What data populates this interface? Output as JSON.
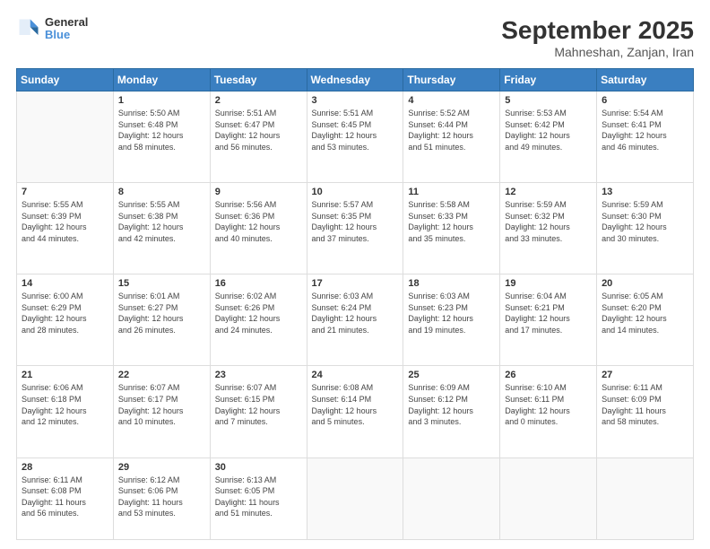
{
  "header": {
    "logo": {
      "line1": "General",
      "line2": "Blue"
    },
    "title": "September 2025",
    "location": "Mahneshan, Zanjan, Iran"
  },
  "days_of_week": [
    "Sunday",
    "Monday",
    "Tuesday",
    "Wednesday",
    "Thursday",
    "Friday",
    "Saturday"
  ],
  "weeks": [
    [
      {
        "day": "",
        "info": ""
      },
      {
        "day": "1",
        "info": "Sunrise: 5:50 AM\nSunset: 6:48 PM\nDaylight: 12 hours\nand 58 minutes."
      },
      {
        "day": "2",
        "info": "Sunrise: 5:51 AM\nSunset: 6:47 PM\nDaylight: 12 hours\nand 56 minutes."
      },
      {
        "day": "3",
        "info": "Sunrise: 5:51 AM\nSunset: 6:45 PM\nDaylight: 12 hours\nand 53 minutes."
      },
      {
        "day": "4",
        "info": "Sunrise: 5:52 AM\nSunset: 6:44 PM\nDaylight: 12 hours\nand 51 minutes."
      },
      {
        "day": "5",
        "info": "Sunrise: 5:53 AM\nSunset: 6:42 PM\nDaylight: 12 hours\nand 49 minutes."
      },
      {
        "day": "6",
        "info": "Sunrise: 5:54 AM\nSunset: 6:41 PM\nDaylight: 12 hours\nand 46 minutes."
      }
    ],
    [
      {
        "day": "7",
        "info": "Sunrise: 5:55 AM\nSunset: 6:39 PM\nDaylight: 12 hours\nand 44 minutes."
      },
      {
        "day": "8",
        "info": "Sunrise: 5:55 AM\nSunset: 6:38 PM\nDaylight: 12 hours\nand 42 minutes."
      },
      {
        "day": "9",
        "info": "Sunrise: 5:56 AM\nSunset: 6:36 PM\nDaylight: 12 hours\nand 40 minutes."
      },
      {
        "day": "10",
        "info": "Sunrise: 5:57 AM\nSunset: 6:35 PM\nDaylight: 12 hours\nand 37 minutes."
      },
      {
        "day": "11",
        "info": "Sunrise: 5:58 AM\nSunset: 6:33 PM\nDaylight: 12 hours\nand 35 minutes."
      },
      {
        "day": "12",
        "info": "Sunrise: 5:59 AM\nSunset: 6:32 PM\nDaylight: 12 hours\nand 33 minutes."
      },
      {
        "day": "13",
        "info": "Sunrise: 5:59 AM\nSunset: 6:30 PM\nDaylight: 12 hours\nand 30 minutes."
      }
    ],
    [
      {
        "day": "14",
        "info": "Sunrise: 6:00 AM\nSunset: 6:29 PM\nDaylight: 12 hours\nand 28 minutes."
      },
      {
        "day": "15",
        "info": "Sunrise: 6:01 AM\nSunset: 6:27 PM\nDaylight: 12 hours\nand 26 minutes."
      },
      {
        "day": "16",
        "info": "Sunrise: 6:02 AM\nSunset: 6:26 PM\nDaylight: 12 hours\nand 24 minutes."
      },
      {
        "day": "17",
        "info": "Sunrise: 6:03 AM\nSunset: 6:24 PM\nDaylight: 12 hours\nand 21 minutes."
      },
      {
        "day": "18",
        "info": "Sunrise: 6:03 AM\nSunset: 6:23 PM\nDaylight: 12 hours\nand 19 minutes."
      },
      {
        "day": "19",
        "info": "Sunrise: 6:04 AM\nSunset: 6:21 PM\nDaylight: 12 hours\nand 17 minutes."
      },
      {
        "day": "20",
        "info": "Sunrise: 6:05 AM\nSunset: 6:20 PM\nDaylight: 12 hours\nand 14 minutes."
      }
    ],
    [
      {
        "day": "21",
        "info": "Sunrise: 6:06 AM\nSunset: 6:18 PM\nDaylight: 12 hours\nand 12 minutes."
      },
      {
        "day": "22",
        "info": "Sunrise: 6:07 AM\nSunset: 6:17 PM\nDaylight: 12 hours\nand 10 minutes."
      },
      {
        "day": "23",
        "info": "Sunrise: 6:07 AM\nSunset: 6:15 PM\nDaylight: 12 hours\nand 7 minutes."
      },
      {
        "day": "24",
        "info": "Sunrise: 6:08 AM\nSunset: 6:14 PM\nDaylight: 12 hours\nand 5 minutes."
      },
      {
        "day": "25",
        "info": "Sunrise: 6:09 AM\nSunset: 6:12 PM\nDaylight: 12 hours\nand 3 minutes."
      },
      {
        "day": "26",
        "info": "Sunrise: 6:10 AM\nSunset: 6:11 PM\nDaylight: 12 hours\nand 0 minutes."
      },
      {
        "day": "27",
        "info": "Sunrise: 6:11 AM\nSunset: 6:09 PM\nDaylight: 11 hours\nand 58 minutes."
      }
    ],
    [
      {
        "day": "28",
        "info": "Sunrise: 6:11 AM\nSunset: 6:08 PM\nDaylight: 11 hours\nand 56 minutes."
      },
      {
        "day": "29",
        "info": "Sunrise: 6:12 AM\nSunset: 6:06 PM\nDaylight: 11 hours\nand 53 minutes."
      },
      {
        "day": "30",
        "info": "Sunrise: 6:13 AM\nSunset: 6:05 PM\nDaylight: 11 hours\nand 51 minutes."
      },
      {
        "day": "",
        "info": ""
      },
      {
        "day": "",
        "info": ""
      },
      {
        "day": "",
        "info": ""
      },
      {
        "day": "",
        "info": ""
      }
    ]
  ]
}
